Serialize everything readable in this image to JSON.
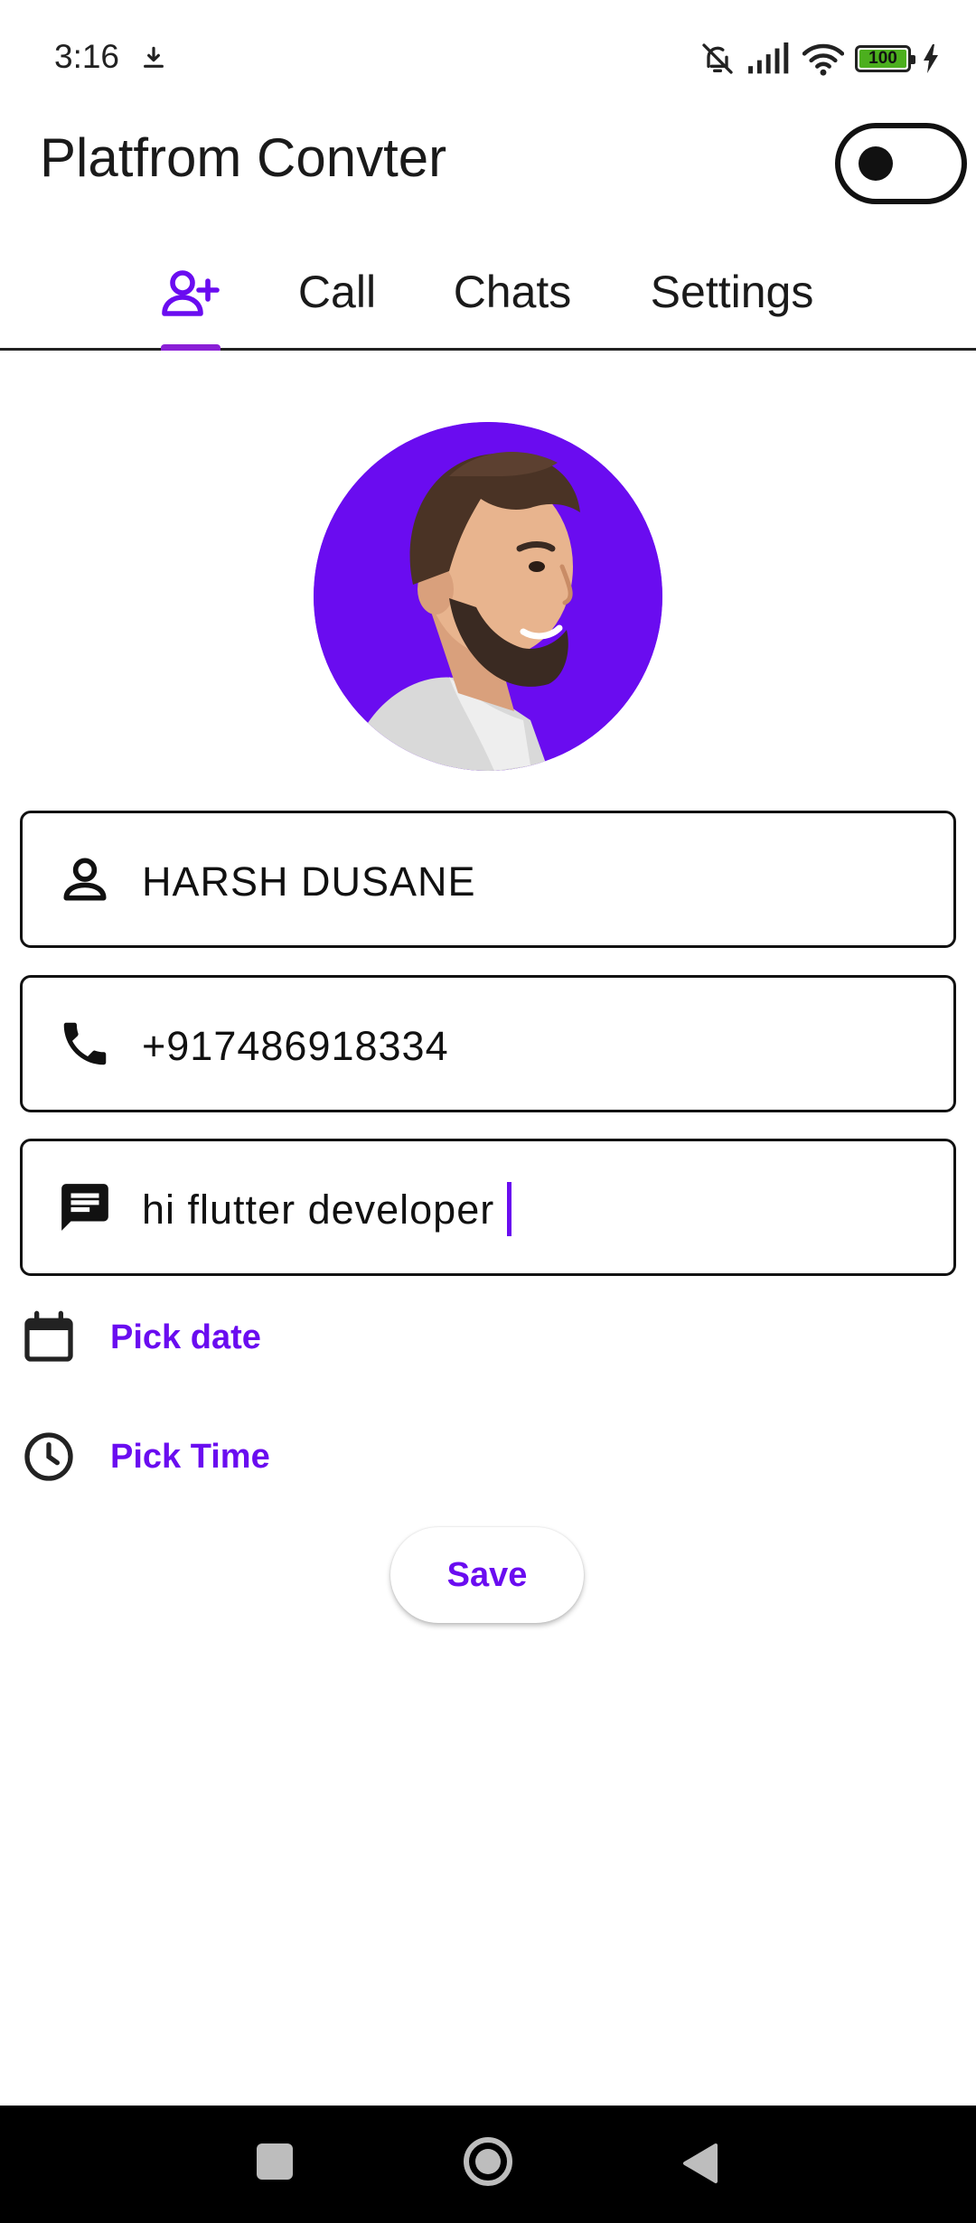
{
  "status_bar": {
    "time": "3:16",
    "battery_level": "100",
    "icons": [
      "download-icon",
      "mute-bell-icon",
      "signal-icon",
      "wifi-icon",
      "battery-icon",
      "charging-bolt-icon"
    ]
  },
  "app_bar": {
    "title": "Platfrom Convter",
    "theme_switch_on": false
  },
  "tabs": [
    {
      "label": "",
      "icon": "add-person-icon",
      "selected": true
    },
    {
      "label": "Call",
      "selected": false
    },
    {
      "label": "Chats",
      "selected": false
    },
    {
      "label": "Settings",
      "selected": false
    }
  ],
  "form": {
    "avatar": "profile-avatar-illustration",
    "name_value": "HARSH DUSANE",
    "phone_value": "+917486918334",
    "chat_value": "hi flutter developer",
    "pick_date_label": "Pick date",
    "pick_time_label": "Pick Time",
    "save_label": "Save"
  },
  "colors": {
    "accent": "#6a0cf0",
    "tab_indicator": "#8a1fd6",
    "avatar_bg": "#6a0cf0",
    "battery_fill": "#4caf1e",
    "nav_bar": "#000000"
  }
}
